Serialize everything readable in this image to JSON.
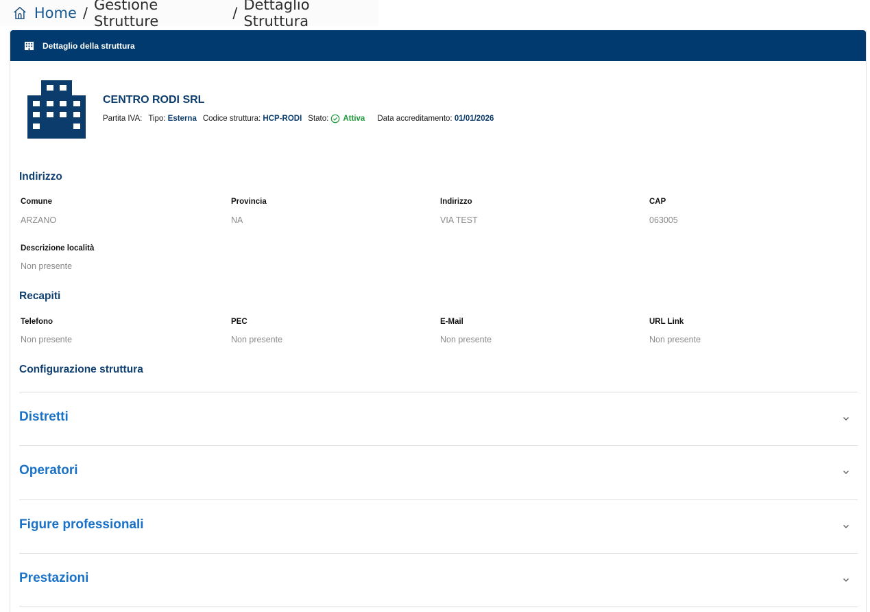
{
  "breadcrumb": {
    "home": "Home",
    "sep1": "/",
    "section": "Gestione Strutture",
    "sep2": "/",
    "current": "Dettaglio Struttura"
  },
  "card": {
    "header_title": "Dettaglio della struttura"
  },
  "structure": {
    "name": "CENTRO RODI SRL",
    "partita_iva_label": "Partita IVA:",
    "tipo_label": "Tipo:",
    "tipo_value": "Esterna",
    "codice_label": "Codice struttura:",
    "codice_value": "HCP-RODI",
    "stato_label": "Stato:",
    "stato_value": "Attiva",
    "data_label": "Data accreditamento:",
    "data_value": "01/01/2026"
  },
  "indirizzo": {
    "title": "Indirizzo",
    "comune_label": "Comune",
    "comune_value": "ARZANO",
    "provincia_label": "Provincia",
    "provincia_value": "NA",
    "indirizzo_label": "Indirizzo",
    "indirizzo_value": "VIA TEST",
    "cap_label": "CAP",
    "cap_value": "063005",
    "descrizione_label": "Descrizione località",
    "descrizione_value": "Non presente"
  },
  "recapiti": {
    "title": "Recapiti",
    "telefono_label": "Telefono",
    "telefono_value": "Non presente",
    "pec_label": "PEC",
    "pec_value": "Non presente",
    "email_label": "E-Mail",
    "email_value": "Non presente",
    "url_label": "URL Link",
    "url_value": "Non presente"
  },
  "configurazione": {
    "title": "Configurazione struttura",
    "sections": [
      "Distretti",
      "Operatori",
      "Figure professionali",
      "Prestazioni"
    ]
  },
  "colors": {
    "header_bg": "#003a6e",
    "accent_blue": "#1a72c7",
    "status_green": "#1f9a3a"
  }
}
